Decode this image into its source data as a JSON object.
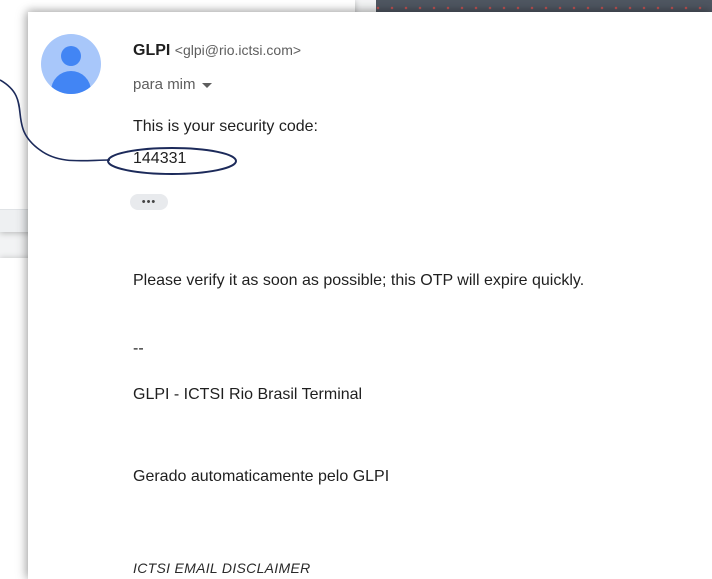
{
  "email": {
    "sender_name": "GLPI",
    "sender_email": "<glpi@rio.ictsi.com>",
    "recipient": "para mim",
    "intro": "This is your security code:",
    "code": "144331",
    "ellipsis": "•••",
    "verify_message": "Please verify it as soon as possible; this OTP will expire quickly.",
    "signature_dash": "--",
    "company": "GLPI - ICTSI Rio Brasil Terminal",
    "auto_generated": "Gerado automaticamente pelo GLPI",
    "disclaimer": "ICTSI EMAIL DISCLAIMER"
  },
  "colors": {
    "annotation": "#1c2a5a",
    "avatar_bg": "#a8c7fa",
    "avatar_fg": "#4285f4"
  },
  "icons": {
    "avatar": "person-icon",
    "recipient_toggle": "caret-down-icon"
  }
}
